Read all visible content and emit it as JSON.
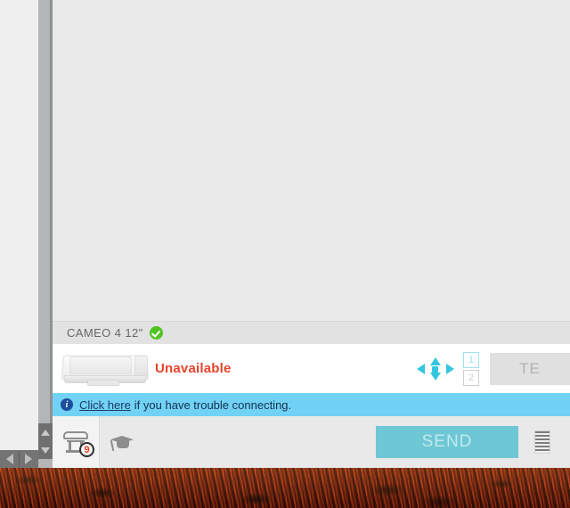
{
  "app": {
    "canvas_label": ""
  },
  "device": {
    "name": "CAMEO 4 12\"",
    "status_badge": "connected-check",
    "status_text": "Unavailable",
    "machine_icon": "cutting-machine-icon"
  },
  "controls": {
    "pan_icon": "pan-arrows-icon",
    "pages": [
      {
        "label": "1",
        "active": true
      },
      {
        "label": "2",
        "active": false
      }
    ],
    "test_button_label": "TE",
    "test_button_full": "TEST"
  },
  "info_bar": {
    "icon": "info-circle-icon",
    "icon_glyph": "i",
    "link_text": "Click here",
    "message": "if you have trouble connecting."
  },
  "toolbar": {
    "cutter_icon": "cutter-settings-icon",
    "cutter_badge": "9",
    "help_icon": "graduation-cap-icon",
    "send_label": "SEND",
    "queue_icon": "job-queue-icon"
  },
  "scrollbars": {
    "vertical_up": "scroll-up-arrow",
    "vertical_down": "scroll-down-arrow",
    "horizontal_left": "scroll-left-arrow",
    "horizontal_right": "scroll-right-arrow"
  },
  "colors": {
    "accent_cyan": "#34c6e0",
    "send_button": "#6ec7d4",
    "info_bar": "#71d2f5",
    "status_red": "#e8422a",
    "check_green": "#4fc421",
    "panel_gray": "#eaeaea"
  }
}
